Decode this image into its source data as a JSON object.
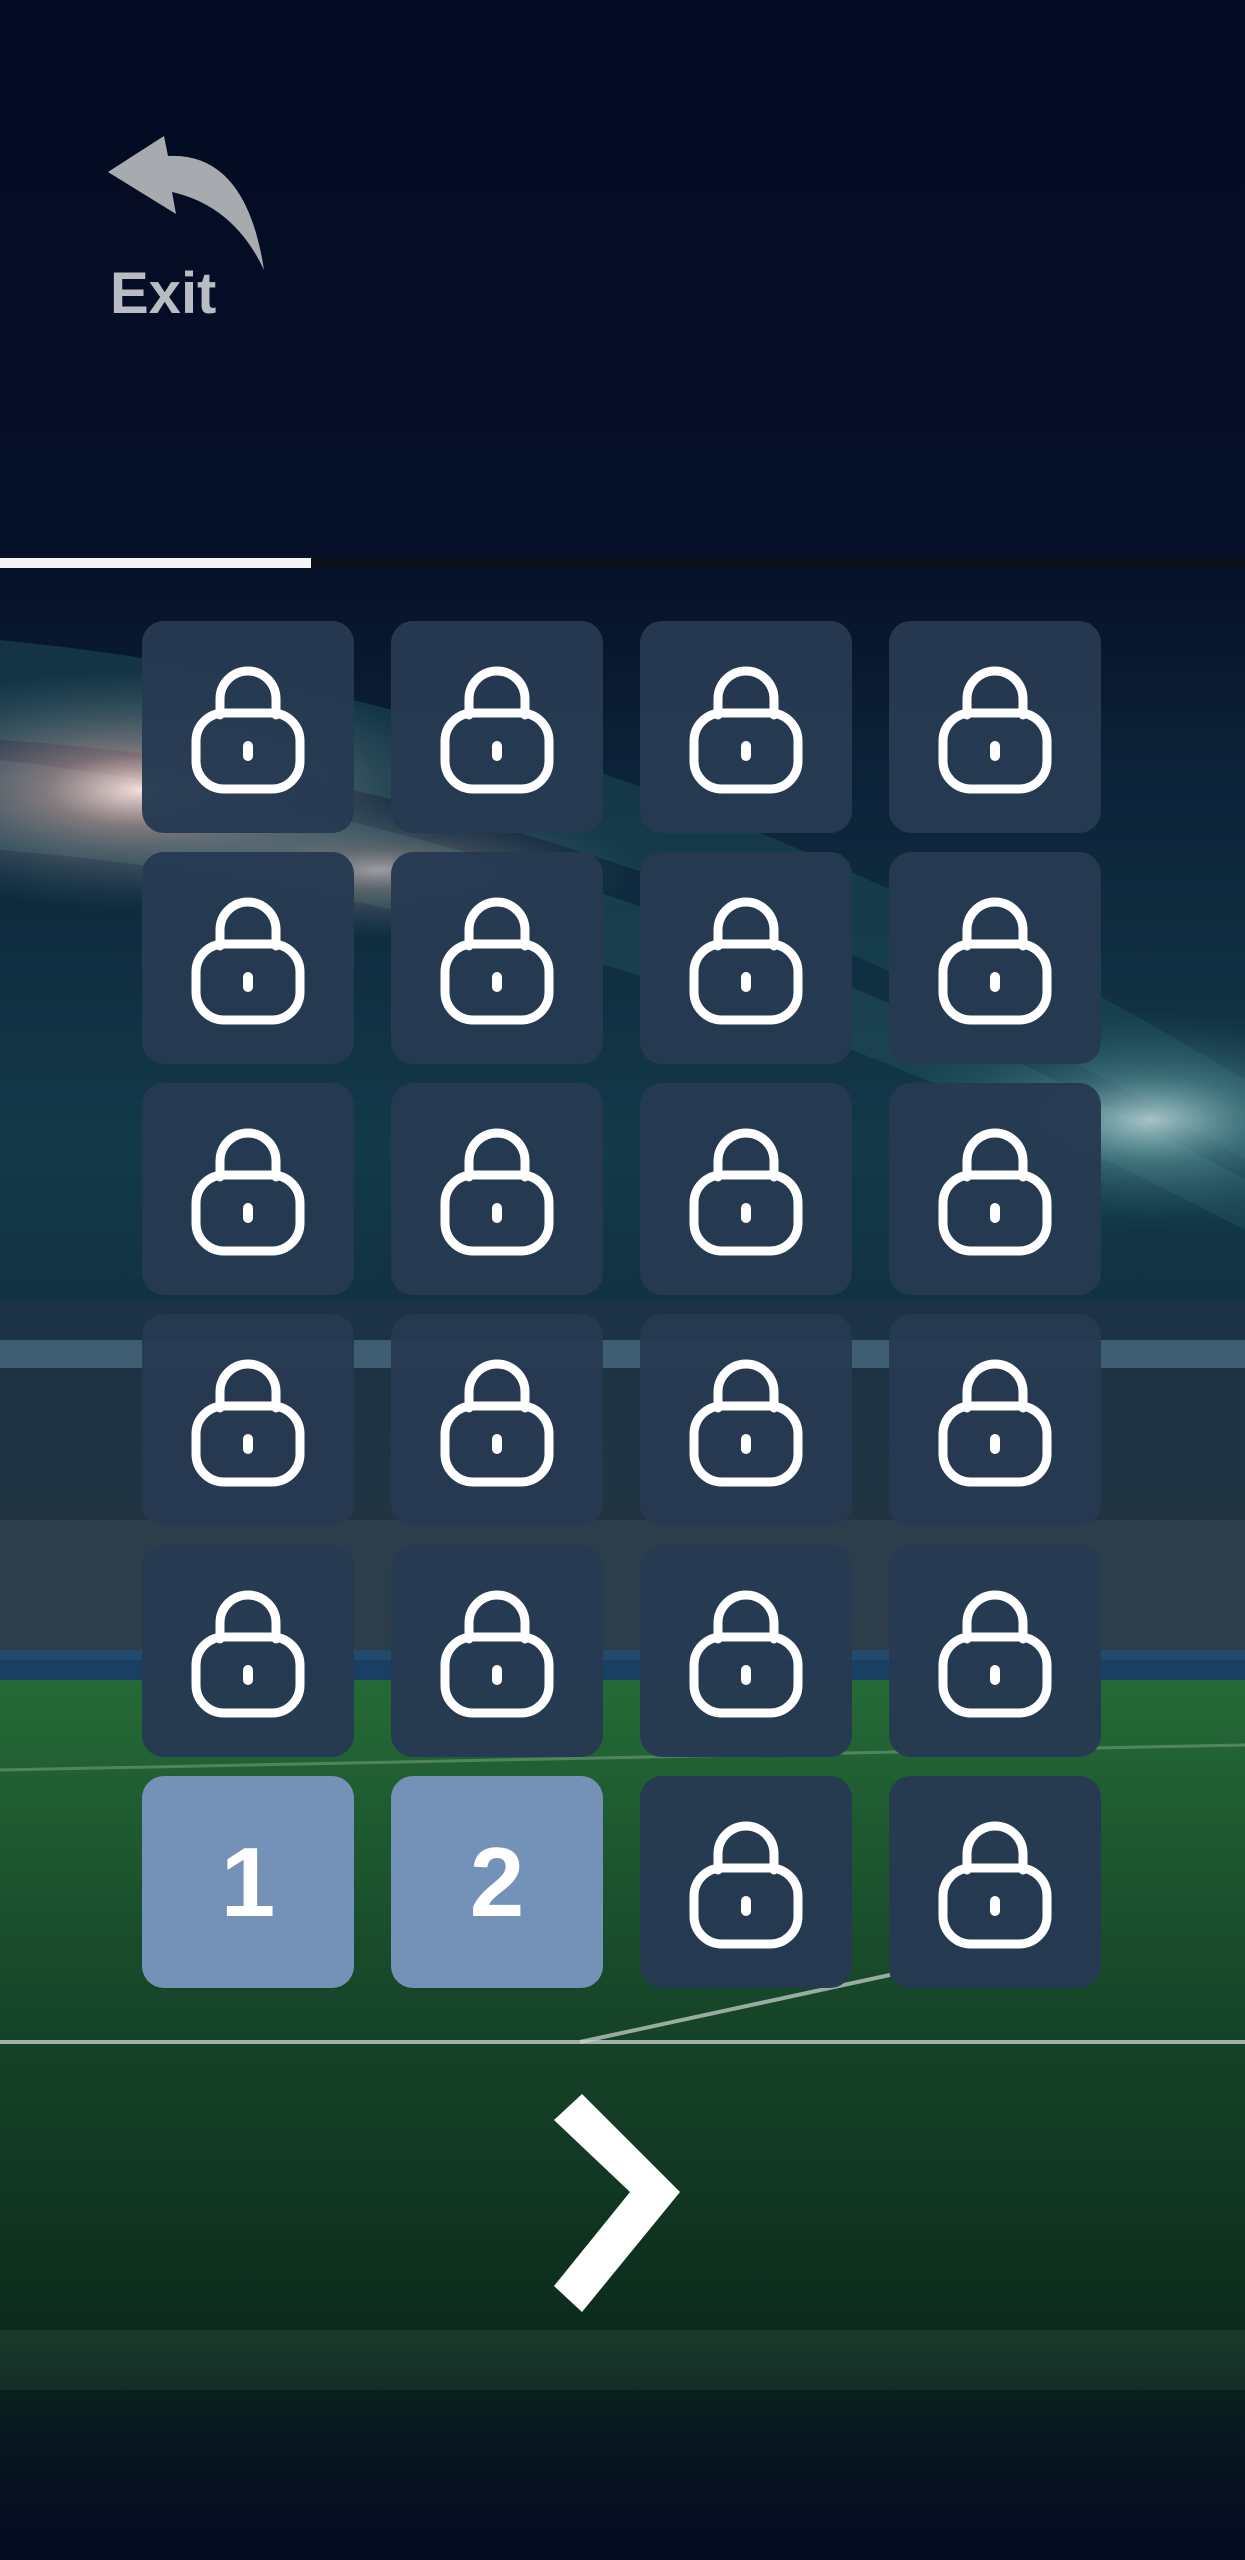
{
  "header": {
    "exit_label": "Exit",
    "exit_icon": "curved-back-arrow-icon"
  },
  "progress": {
    "fraction": 0.25
  },
  "levels": {
    "tiles": [
      {
        "state": "locked",
        "label": ""
      },
      {
        "state": "locked",
        "label": ""
      },
      {
        "state": "locked",
        "label": ""
      },
      {
        "state": "locked",
        "label": ""
      },
      {
        "state": "locked",
        "label": ""
      },
      {
        "state": "locked",
        "label": ""
      },
      {
        "state": "locked",
        "label": ""
      },
      {
        "state": "locked",
        "label": ""
      },
      {
        "state": "locked",
        "label": ""
      },
      {
        "state": "locked",
        "label": ""
      },
      {
        "state": "locked",
        "label": ""
      },
      {
        "state": "locked",
        "label": ""
      },
      {
        "state": "locked",
        "label": ""
      },
      {
        "state": "locked",
        "label": ""
      },
      {
        "state": "locked",
        "label": ""
      },
      {
        "state": "locked",
        "label": ""
      },
      {
        "state": "locked",
        "label": ""
      },
      {
        "state": "locked",
        "label": ""
      },
      {
        "state": "locked",
        "label": ""
      },
      {
        "state": "locked",
        "label": ""
      },
      {
        "state": "unlocked",
        "label": "1"
      },
      {
        "state": "unlocked",
        "label": "2"
      },
      {
        "state": "locked",
        "label": ""
      },
      {
        "state": "locked",
        "label": ""
      }
    ],
    "locked_icon": "padlock-icon"
  },
  "navigation": {
    "next_icon": "chevron-right-icon"
  },
  "colors": {
    "locked_tile": "#263a52",
    "unlocked_tile": "#7491b7",
    "background": "#050c22",
    "pitch": "#1d5a2e"
  }
}
